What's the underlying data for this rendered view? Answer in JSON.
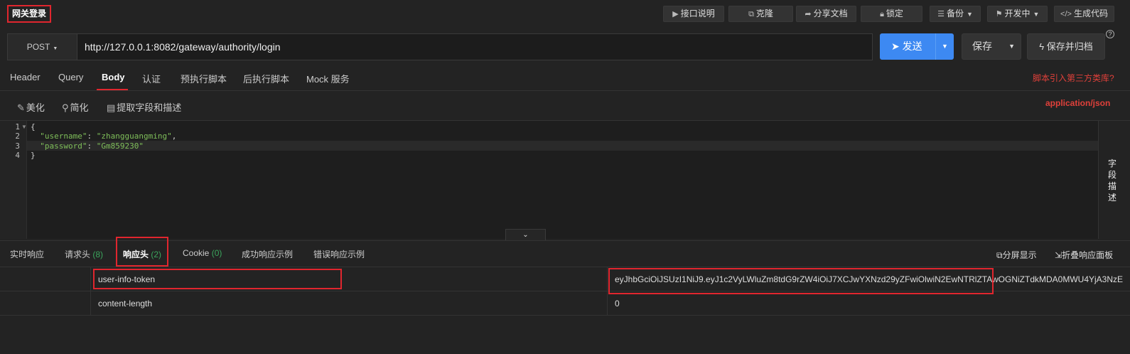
{
  "top": {
    "title": "网关登录",
    "buttons": {
      "docs": "接口说明",
      "clone": "克隆",
      "share": "分享文档",
      "lock": "锁定",
      "backup": "备份",
      "status": "开发中",
      "gencode": "生成代码"
    }
  },
  "request": {
    "method": "POST",
    "url": "http://127.0.0.1:8082/gateway/authority/login",
    "send_label": "发送",
    "save_label": "保存",
    "save_archive_label": "保存并归档"
  },
  "tabs": {
    "items": [
      "Header",
      "Query",
      "Body",
      "认证",
      "预执行脚本",
      "后执行脚本",
      "Mock 服务"
    ],
    "active": "Body",
    "lib_link": "脚本引入第三方类库?"
  },
  "body_toolbar": {
    "beautify": "美化",
    "simplify": "简化",
    "extract": "提取字段和描述",
    "content_type": "application/json"
  },
  "editor": {
    "lines": [
      "1",
      "2",
      "3",
      "4"
    ],
    "open_brace": "{",
    "close_brace": "}",
    "username_key": "\"username\"",
    "username_value": "\"zhangguangming\"",
    "password_key": "\"password\"",
    "password_value": "\"Gm859230\"",
    "side_label": "字段描述"
  },
  "response": {
    "tabs": {
      "realtime": "实时响应",
      "req_headers": "请求头",
      "req_headers_count": "(8)",
      "resp_headers": "响应头",
      "resp_headers_count": "(2)",
      "cookie": "Cookie",
      "cookie_count": "(0)",
      "success_example": "成功响应示例",
      "error_example": "错误响应示例"
    },
    "split_view": "分屏显示",
    "collapse_panel": "折叠响应面板",
    "headers": [
      {
        "name": "user-info-token",
        "value": "eyJhbGciOiJSUzI1NiJ9.eyJ1c2VyLWluZm8tdG9rZW4iOiJ7XCJwYXNzd29yZFwiOlwiN2EwNTRlZTAwOGNiZTdkMDA0MWU4YjA3NzE"
      },
      {
        "name": "content-length",
        "value": "0"
      }
    ]
  },
  "colors": {
    "accent": "#3d89f2",
    "highlight": "#e0262e",
    "count": "#3ba55c"
  }
}
